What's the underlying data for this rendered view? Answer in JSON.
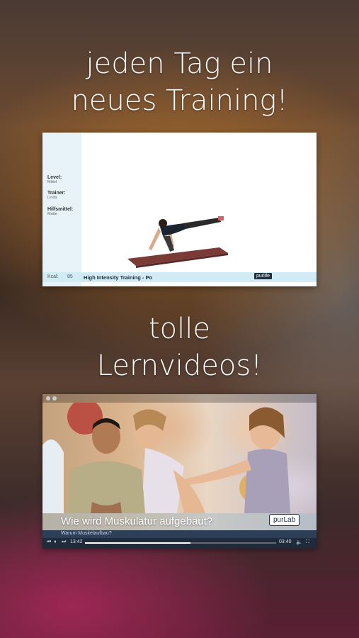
{
  "headline1": {
    "line1": "jeden Tag ein",
    "line2": "neues Training!"
  },
  "headline2": {
    "line1": "tolle",
    "line2": "Lernvideos!"
  },
  "screenshot1": {
    "info": [
      {
        "key": "Level:",
        "value": "Mittel"
      },
      {
        "key": "Trainer:",
        "value": "Linda"
      },
      {
        "key": "Hilfsmittel:",
        "value": "Matte"
      }
    ],
    "kcal_label": "Kcal:",
    "kcal_value": "85",
    "title": "High Intensity Training - Po",
    "brand": "purlife"
  },
  "screenshot2": {
    "caption": "Wie wird Muskulatur aufgebaut?",
    "brand": "purLab",
    "subtitle": "Warum Muskelaufbau?",
    "time_elapsed": "13:42",
    "time_total": "03:40",
    "progress": 0.55
  },
  "colors": {
    "mat": "#7a3a36",
    "bar": "#d2ecf6",
    "brand_dark": "#1e2f44"
  }
}
